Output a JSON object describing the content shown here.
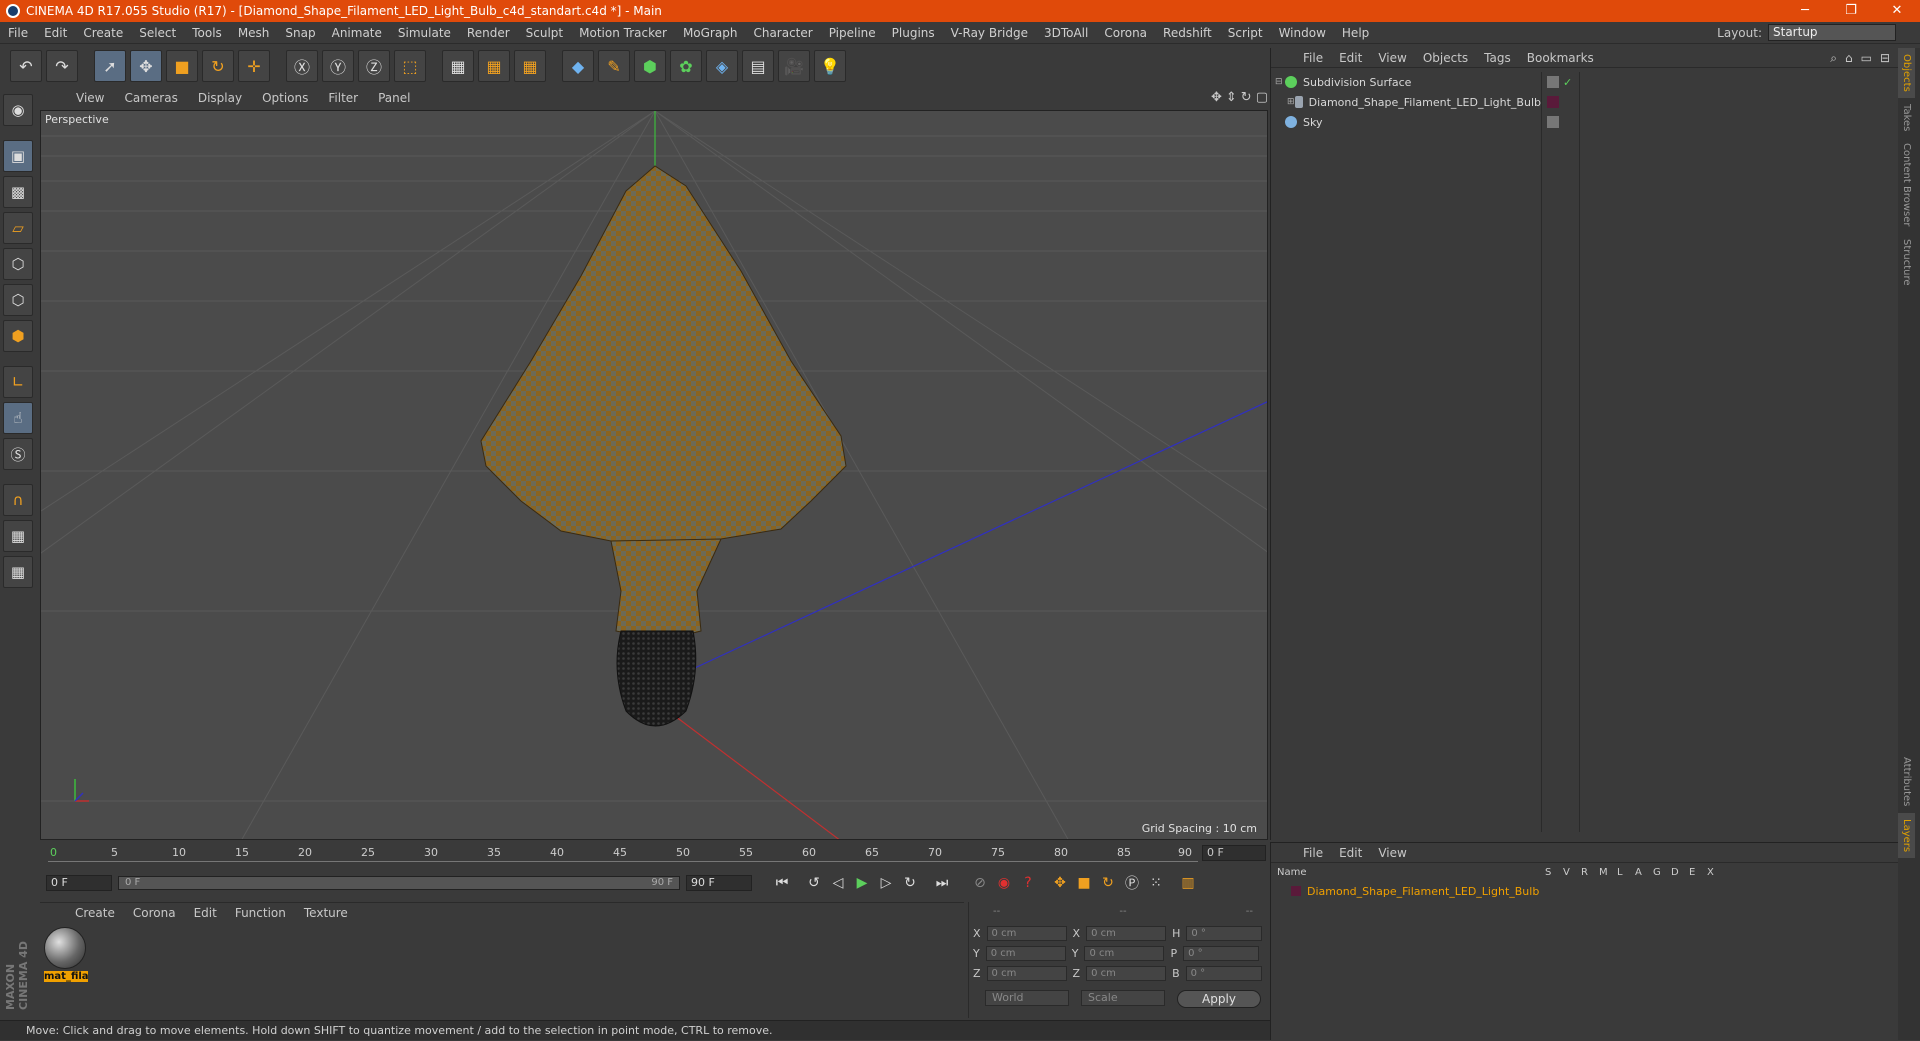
{
  "window": {
    "title": "CINEMA 4D R17.055 Studio (R17) - [Diamond_Shape_Filament_LED_Light_Bulb_c4d_standart.c4d *] - Main",
    "min": "─",
    "max": "❐",
    "close": "✕"
  },
  "menu": [
    "File",
    "Edit",
    "Create",
    "Select",
    "Tools",
    "Mesh",
    "Snap",
    "Animate",
    "Simulate",
    "Render",
    "Sculpt",
    "Motion Tracker",
    "MoGraph",
    "Character",
    "Pipeline",
    "Plugins",
    "V-Ray Bridge",
    "3DToAll",
    "Corona",
    "Redshift",
    "Script",
    "Window",
    "Help"
  ],
  "layout": {
    "label": "Layout:",
    "value": "Startup"
  },
  "viewport": {
    "menu": [
      "View",
      "Cameras",
      "Display",
      "Options",
      "Filter",
      "Panel"
    ],
    "label": "Perspective",
    "grid_spacing": "Grid Spacing : 10 cm"
  },
  "timeline": {
    "ticks": [
      "0",
      "5",
      "10",
      "15",
      "20",
      "25",
      "30",
      "35",
      "40",
      "45",
      "50",
      "55",
      "60",
      "65",
      "70",
      "75",
      "80",
      "85",
      "90"
    ],
    "current_frame": "0 F"
  },
  "playback": {
    "start": "0 F",
    "range_start": "0 F",
    "range_end": "90 F",
    "end": "90 F"
  },
  "material": {
    "menu": [
      "Create",
      "Corona",
      "Edit",
      "Function",
      "Texture"
    ],
    "items": [
      {
        "name": "mat_fila"
      }
    ]
  },
  "coords": {
    "header": [
      "--",
      "--",
      "--"
    ],
    "rows": [
      {
        "a": "X",
        "av": "0 cm",
        "b": "X",
        "bv": "0 cm",
        "c": "H",
        "cv": "0 °"
      },
      {
        "a": "Y",
        "av": "0 cm",
        "b": "Y",
        "bv": "0 cm",
        "c": "P",
        "cv": "0 °"
      },
      {
        "a": "Z",
        "av": "0 cm",
        "b": "Z",
        "bv": "0 cm",
        "c": "B",
        "cv": "0 °"
      }
    ],
    "world": "World",
    "scale": "Scale",
    "apply": "Apply"
  },
  "objects": {
    "menu": [
      "File",
      "Edit",
      "View",
      "Objects",
      "Tags",
      "Bookmarks"
    ],
    "items": [
      {
        "name": "Subdivision Surface",
        "color": "#5ccf5c"
      },
      {
        "name": "Diamond_Shape_Filament_LED_Light_Bulb",
        "color": "#9aa4b0"
      },
      {
        "name": "Sky",
        "color": "#7fb2e0"
      }
    ]
  },
  "layers": {
    "menu": [
      "File",
      "Edit",
      "View"
    ],
    "columns": [
      "Name",
      "S",
      "V",
      "R",
      "M",
      "L",
      "A",
      "G",
      "D",
      "E",
      "X"
    ],
    "row": "Diamond_Shape_Filament_LED_Light_Bulb"
  },
  "side_tabs": [
    "Objects",
    "Takes",
    "Content Browser",
    "Structure"
  ],
  "side_tabs_bottom": [
    "Attributes",
    "Layers"
  ],
  "brand": "MAXON CINEMA 4D",
  "status": "Move: Click and drag to move elements. Hold down SHIFT to quantize movement / add to the selection in point mode, CTRL to remove."
}
